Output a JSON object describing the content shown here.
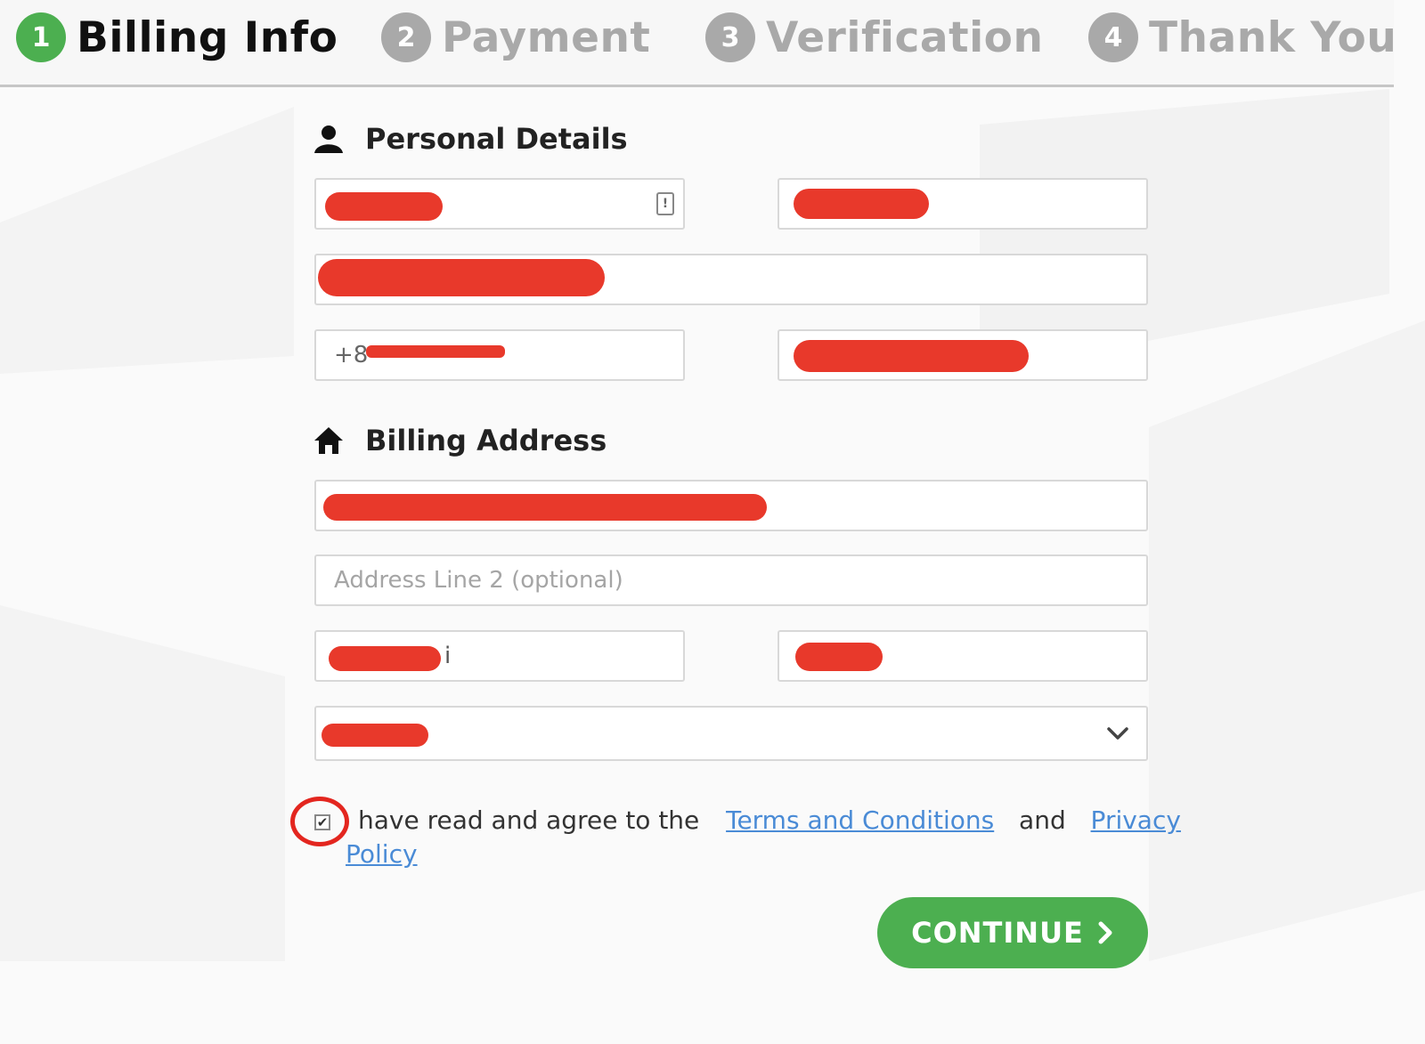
{
  "steps": [
    {
      "number": "1",
      "label": "Billing Info",
      "state": "active"
    },
    {
      "number": "2",
      "label": "Payment",
      "state": "inactive"
    },
    {
      "number": "3",
      "label": "Verification",
      "state": "inactive"
    },
    {
      "number": "4",
      "label": "Thank You",
      "state": "inactive"
    }
  ],
  "personal": {
    "title": "Personal Details",
    "icon": "user-icon",
    "phone_prefix": "+8"
  },
  "billing": {
    "title": "Billing Address",
    "icon": "home-icon",
    "address_line2_placeholder": "Address Line 2 (optional)",
    "city_visible_suffix": "i"
  },
  "agreement": {
    "checked": true,
    "text_before": "have read and agree to the",
    "terms_link": "Terms and Conditions",
    "and_text": "and",
    "privacy_link_part1": "Privacy",
    "privacy_link_part2": "Policy"
  },
  "continue_button": {
    "label": "CONTINUE"
  },
  "colors": {
    "accent_green": "#4caf50",
    "inactive_gray": "#a9a9a9",
    "redaction_red": "#e8392b",
    "link_blue": "#4a8bd6"
  }
}
